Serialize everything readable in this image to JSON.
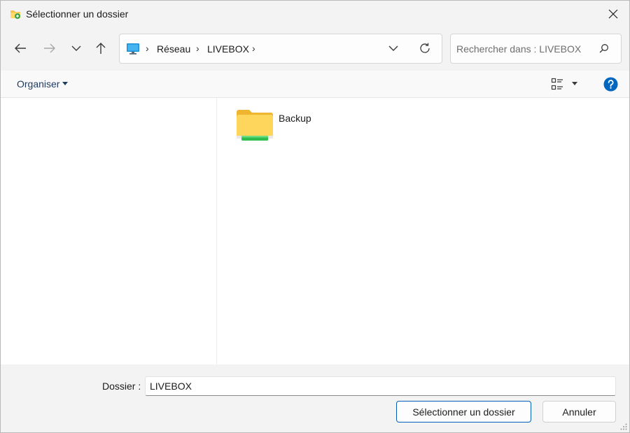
{
  "window": {
    "title": "Sélectionner un dossier"
  },
  "address": {
    "breadcrumbs": [
      "Réseau",
      "LIVEBOX"
    ]
  },
  "search": {
    "placeholder": "Rechercher dans : LIVEBOX"
  },
  "toolbar": {
    "organise_label": "Organiser"
  },
  "content": {
    "items": [
      {
        "name": "Backup",
        "icon": "network-folder-icon"
      }
    ]
  },
  "footer": {
    "folder_label": "Dossier :",
    "folder_value": "LIVEBOX",
    "select_label": "Sélectionner un dossier",
    "cancel_label": "Annuler"
  },
  "colors": {
    "accent": "#005fb8",
    "help": "#0067c0",
    "folder": "#ffd65c",
    "network_bar": "#2ebd4e"
  }
}
